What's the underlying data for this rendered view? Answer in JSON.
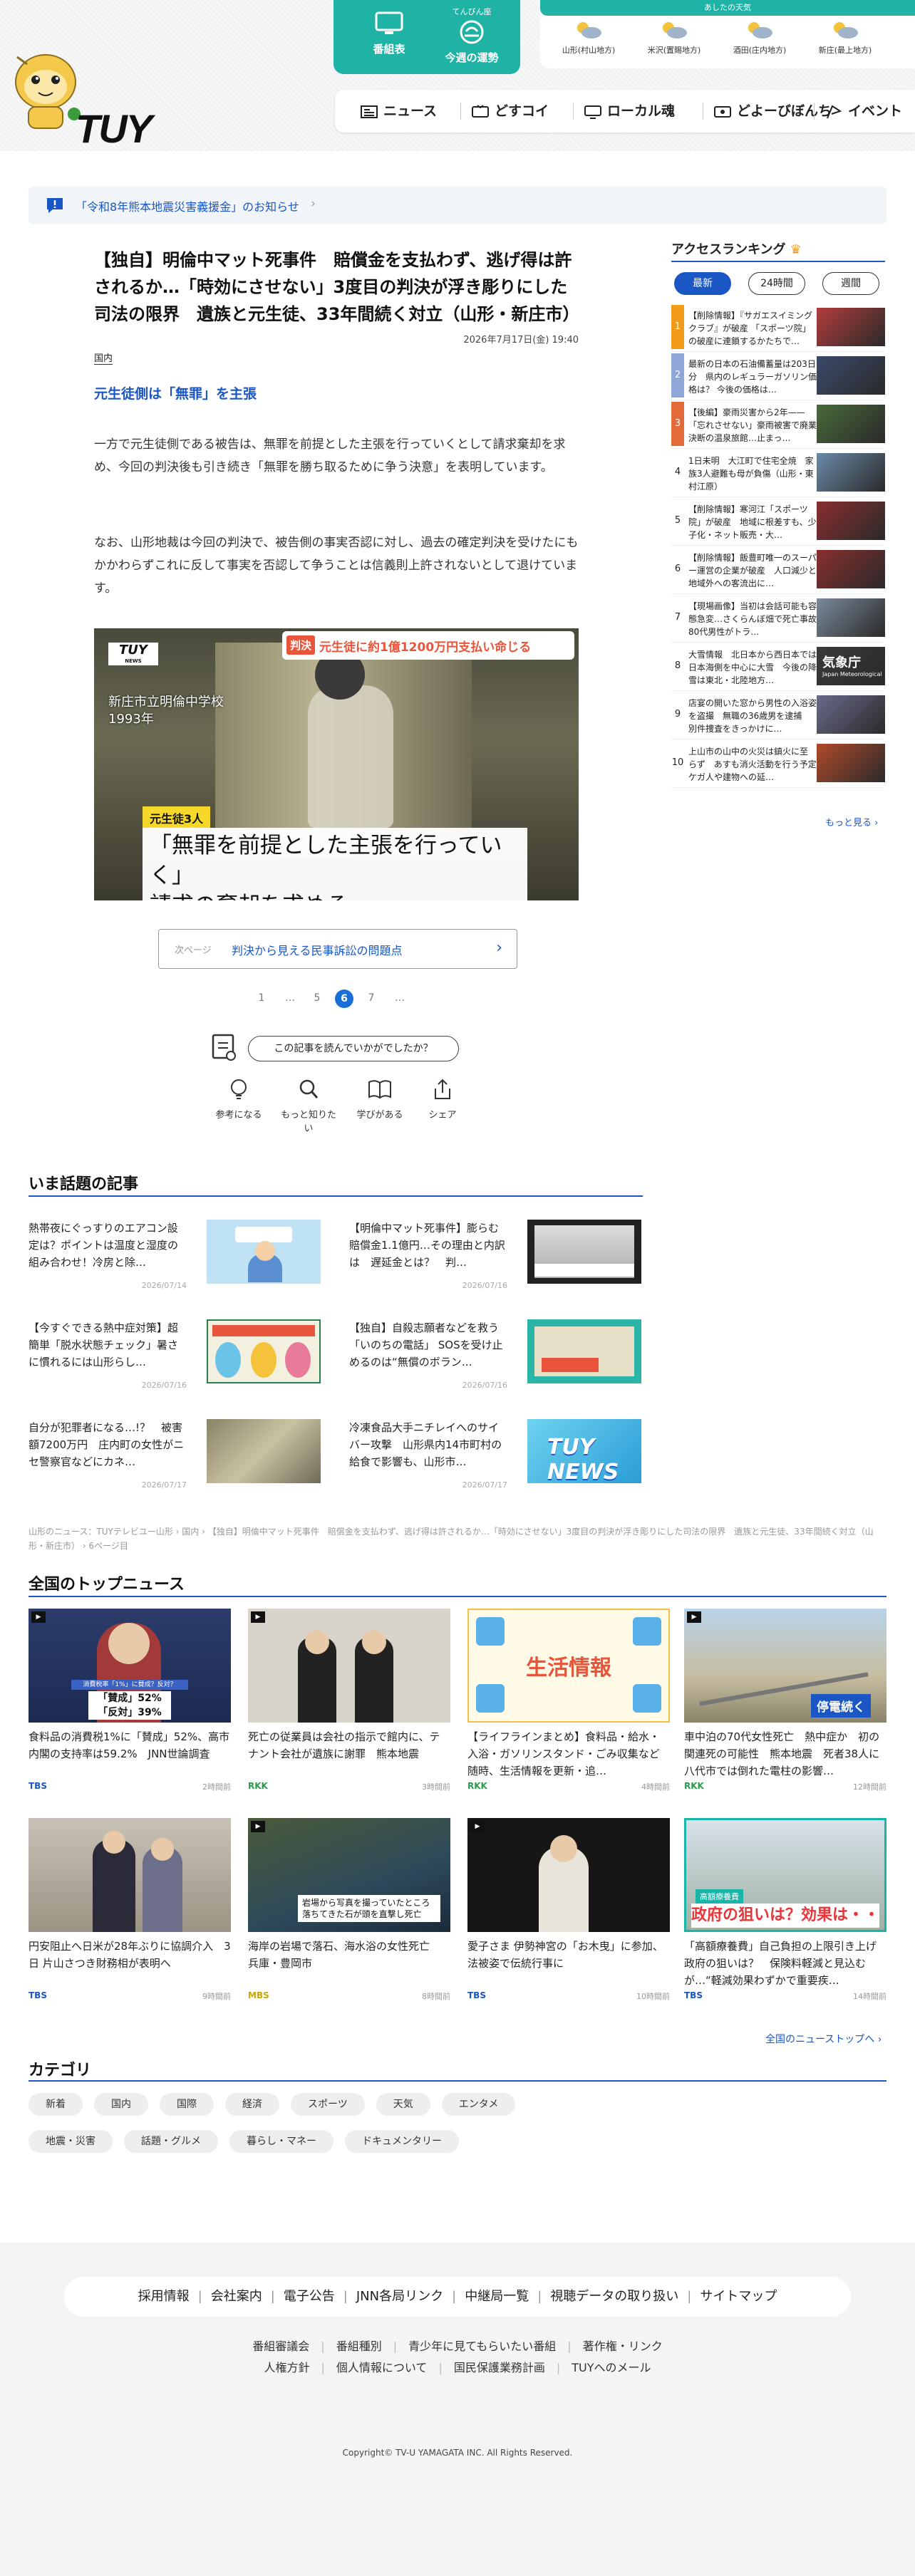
{
  "header": {
    "logo_text": "TUY",
    "quick_buttons": [
      {
        "label": "番組表",
        "small": ""
      },
      {
        "label": "今週の運勢",
        "small": "てんびん座"
      }
    ],
    "weather": {
      "heading": "あしたの天気",
      "areas": [
        "山形(村山地方)",
        "米沢(置賜地方)",
        "酒田(庄内地方)",
        "新庄(最上地方)"
      ]
    },
    "nav": [
      "ニュース",
      "どすコイ",
      "ローカル魂",
      "どよーびぼんち",
      "イベント"
    ]
  },
  "notice": {
    "text": "「令和8年熊本地震災害義援金」のお知らせ"
  },
  "article": {
    "title": "【独自】明倫中マット死事件　賠償金を支払わず、逃げ得は許されるか…「時効にさせない」3度目の判決が浮き彫りにした司法の限界　遺族と元生徒、33年間続く対立（山形・新庄市）",
    "date": "2026年7月17日(金) 19:40",
    "category": "国内",
    "subheading": "元生徒側は「無罪」を主張",
    "paragraphs": [
      "一方で元生徒側である被告は、無罪を前提とした主張を行っていくとして請求棄却を求め、今回の判決後も引き続き「無罪を勝ち取るために争う決意」を表明しています。",
      "なお、山形地裁は今回の判決で、被告側の事実否認に対し、過去の確定判決を受けたにもかかわらずこれに反して事実を否認して争うことは信義則上許されないとして退けています。"
    ],
    "photo": {
      "channel_logo": "TUY",
      "channel_sub": "NEWS",
      "banner_tag": "判決",
      "banner_text": "元生徒に約1億1200万円支払い命じる",
      "location_line1": "新庄市立明倫中学校",
      "location_line2": "1993年",
      "speaker": "元生徒3人",
      "caption_line1": "「無罪を前提とした主張を行っていく」",
      "caption_line2": "請求の棄却を求める"
    },
    "next_page": {
      "label": "次ページ",
      "title": "判決から見える民事訴訟の問題点"
    },
    "pagination": [
      "1",
      "…",
      "5",
      "6",
      "7",
      "…"
    ],
    "current_page": "6",
    "feedback": {
      "question": "この記事を読んでいかがでしたか？",
      "buttons": [
        "参考になる",
        "もっと知りたい",
        "学びがある",
        "シェア"
      ]
    }
  },
  "ranking": {
    "title": "アクセスランキング",
    "tabs": [
      "最新",
      "24時間",
      "週間"
    ],
    "active_tab": "最新",
    "items": [
      {
        "rank": "1",
        "text": "【削除情報】『サガエスイミングクラブ』が破産 「スポーツ院」の破産に連鎖するかたちで…",
        "accent": "#f39c1a"
      },
      {
        "rank": "2",
        "text": "最新の日本の石油備蓄量は203日分　県内のレギュラーガソリン価格は？ 今後の価格は…",
        "accent": "#8fa7d8"
      },
      {
        "rank": "3",
        "text": "【後編】豪雨災害から2年——「忘れさせない」豪雨被害で廃業決断の温泉旅館…止まっ…",
        "accent": "#e36b3a"
      },
      {
        "rank": "4",
        "text": "1日未明　大江町で住宅全焼　家族3人避難も母が負傷（山形・東村江原）",
        "accent": ""
      },
      {
        "rank": "5",
        "text": "【削除情報】寒河江「スポーツ院」が破産　地域に根差すも、少子化・ネット販売・大…",
        "accent": ""
      },
      {
        "rank": "6",
        "text": "【削除情報】飯豊町唯一のスーパー運営の企業が破産　人口減少と地域外への客流出に…",
        "accent": ""
      },
      {
        "rank": "7",
        "text": "【現場画像】当初は会話可能も容態急変…さくらんぼ畑で死亡事故　80代男性がトラ…",
        "accent": ""
      },
      {
        "rank": "8",
        "text": "大雪情報　北日本から西日本では日本海側を中心に大雪　今後の降雪は東北・北陸地方…",
        "accent": ""
      },
      {
        "rank": "9",
        "text": "店宴の開いた窓から男性の入浴姿を盗撮　無職の36歳男を逮捕　別件捜査をきっかけに…",
        "accent": ""
      },
      {
        "rank": "10",
        "text": "上山市の山中の火災は鎮火に至らず　あすも消火活動を行う予定　ケガ人や建物への延…",
        "accent": ""
      }
    ],
    "more": "もっと見る"
  },
  "hot": {
    "title": "いま話題の記事",
    "items": [
      {
        "text": "熱帯夜にぐっすりのエアコン設定は？ポイントは温度と湿度の組み合わせ！冷房と除…",
        "date": "2026/07/14"
      },
      {
        "text": "【明倫中マット死事件】膨らむ賠償金1.1億円…その理由と内訳は　遅延金とは？　判…",
        "date": "2026/07/16"
      },
      {
        "text": "【今すぐできる熱中症対策】超簡単「脱水状態チェック」暑さに慣れるには山形らし…",
        "date": "2026/07/16"
      },
      {
        "text": "【独自】自殺志願者などを救う「いのちの電話」 SOSを受け止めるのは“無償のボラン…",
        "date": "2026/07/16"
      },
      {
        "text": "自分が犯罪者になる…!？　被害額7200万円　庄内町の女性がニセ警察官などにカネ…",
        "date": "2026/07/17"
      },
      {
        "text": "冷凍食品大手ニチレイへのサイバー攻撃　山形県内14市町村の給食で影響も、山形市…",
        "date": "2026/07/17"
      }
    ]
  },
  "breadcrumb": [
    "山形のニュース：TUYテレビユー山形",
    "国内",
    "【独自】明倫中マット死事件　賠償金を支払わず、逃げ得は許されるか…「時効にさせない」3度目の判決が浮き彫りにした司法の限界　遺族と元生徒、33年間続く対立（山形・新庄市）",
    "6ページ目"
  ],
  "national": {
    "title": "全国のトップニュース",
    "items": [
      {
        "text": "食料品の消費税1%に「賛成」52%、高市内閣の支持率は59.2%　JNN世論調査",
        "source": "TBS",
        "date": "2時間前",
        "color": "#1a56c4"
      },
      {
        "text": "死亡の従業員は会社の指示で館内に、テナント会社が遺族に謝罪　熊本地震",
        "source": "RKK",
        "date": "3時間前",
        "color": "#2a9a4a"
      },
      {
        "text": "【ライフラインまとめ】食料品・給水・入浴・ガソリンスタンド・ごみ収集など　随時、生活情報を更新・追…",
        "source": "RKK",
        "date": "4時間前",
        "color": "#2a9a4a"
      },
      {
        "text": "車中泊の70代女性死亡　熱中症か　初の関連死の可能性　熊本地震　死者38人に　八代市では倒れた電柱の影響…",
        "source": "RKK",
        "date": "12時間前",
        "color": "#2a9a4a"
      },
      {
        "text": "円安阻止へ日米が28年ぶりに協調介入　3日 片山さつき財務相が表明へ",
        "source": "TBS",
        "date": "9時間前",
        "color": "#1a56c4"
      },
      {
        "text": "海岸の岩場で落石、海水浴の女性死亡　兵庫・豊岡市",
        "source": "MBS",
        "date": "8時間前",
        "color": "#c8a800"
      },
      {
        "text": "愛子さま 伊勢神宮の「お木曳」に参加、法被姿で伝統行事に",
        "source": "TBS",
        "date": "10時間前",
        "color": "#1a56c4"
      },
      {
        "text": "「高額療養費」自己負担の上限引き上げ　政府の狙いは？　保険料軽減と見込む が…“軽減効果わずかで重要疾…",
        "source": "TBS",
        "date": "14時間前",
        "color": "#1a56c4"
      }
    ],
    "more": "全国のニューストップへ"
  },
  "thumbs": {
    "poll_tag": "消費税率「1%」に賛成？反対？",
    "poll_yes": "「賛成」52%",
    "poll_no": "「反対」39%",
    "life_info": "生活情報",
    "outage": "停電続く",
    "rock_line1": "岩場から写真を撮っていたところ",
    "rock_line2": "落ちてきた石が頭を直撃し死亡",
    "health_tag": "高額療養費",
    "health_text": "政府の狙いは？効果は・・",
    "hot_news": "TUY NEWS",
    "kiseki": "気象庁",
    "kiseki_sub": "Japan Meteorological"
  },
  "categories": {
    "title": "カテゴリ",
    "items": [
      "新着",
      "国内",
      "国際",
      "経済",
      "スポーツ",
      "天気",
      "エンタメ",
      "地震・災害",
      "話題・グルメ",
      "暮らし・マネー",
      "ドキュメンタリー"
    ]
  },
  "footer": {
    "main_links": [
      "採用情報",
      "会社案内",
      "電子公告",
      "JNN各局リンク",
      "中継局一覧",
      "視聴データの取り扱い",
      "サイトマップ"
    ],
    "row1": [
      "番組審議会",
      "番組種別",
      "青少年に見てもらいたい番組",
      "著作権・リンク"
    ],
    "row2": [
      "人権方針",
      "個人情報について",
      "国民保護業務計画",
      "TUYへのメール"
    ],
    "copyright": "Copyright© TV-U YAMAGATA INC. All Rights Reserved."
  },
  "colors": {
    "accent": "#1a56c4",
    "teal": "#1fb3a6",
    "rank_orange": "#f39c1a"
  }
}
